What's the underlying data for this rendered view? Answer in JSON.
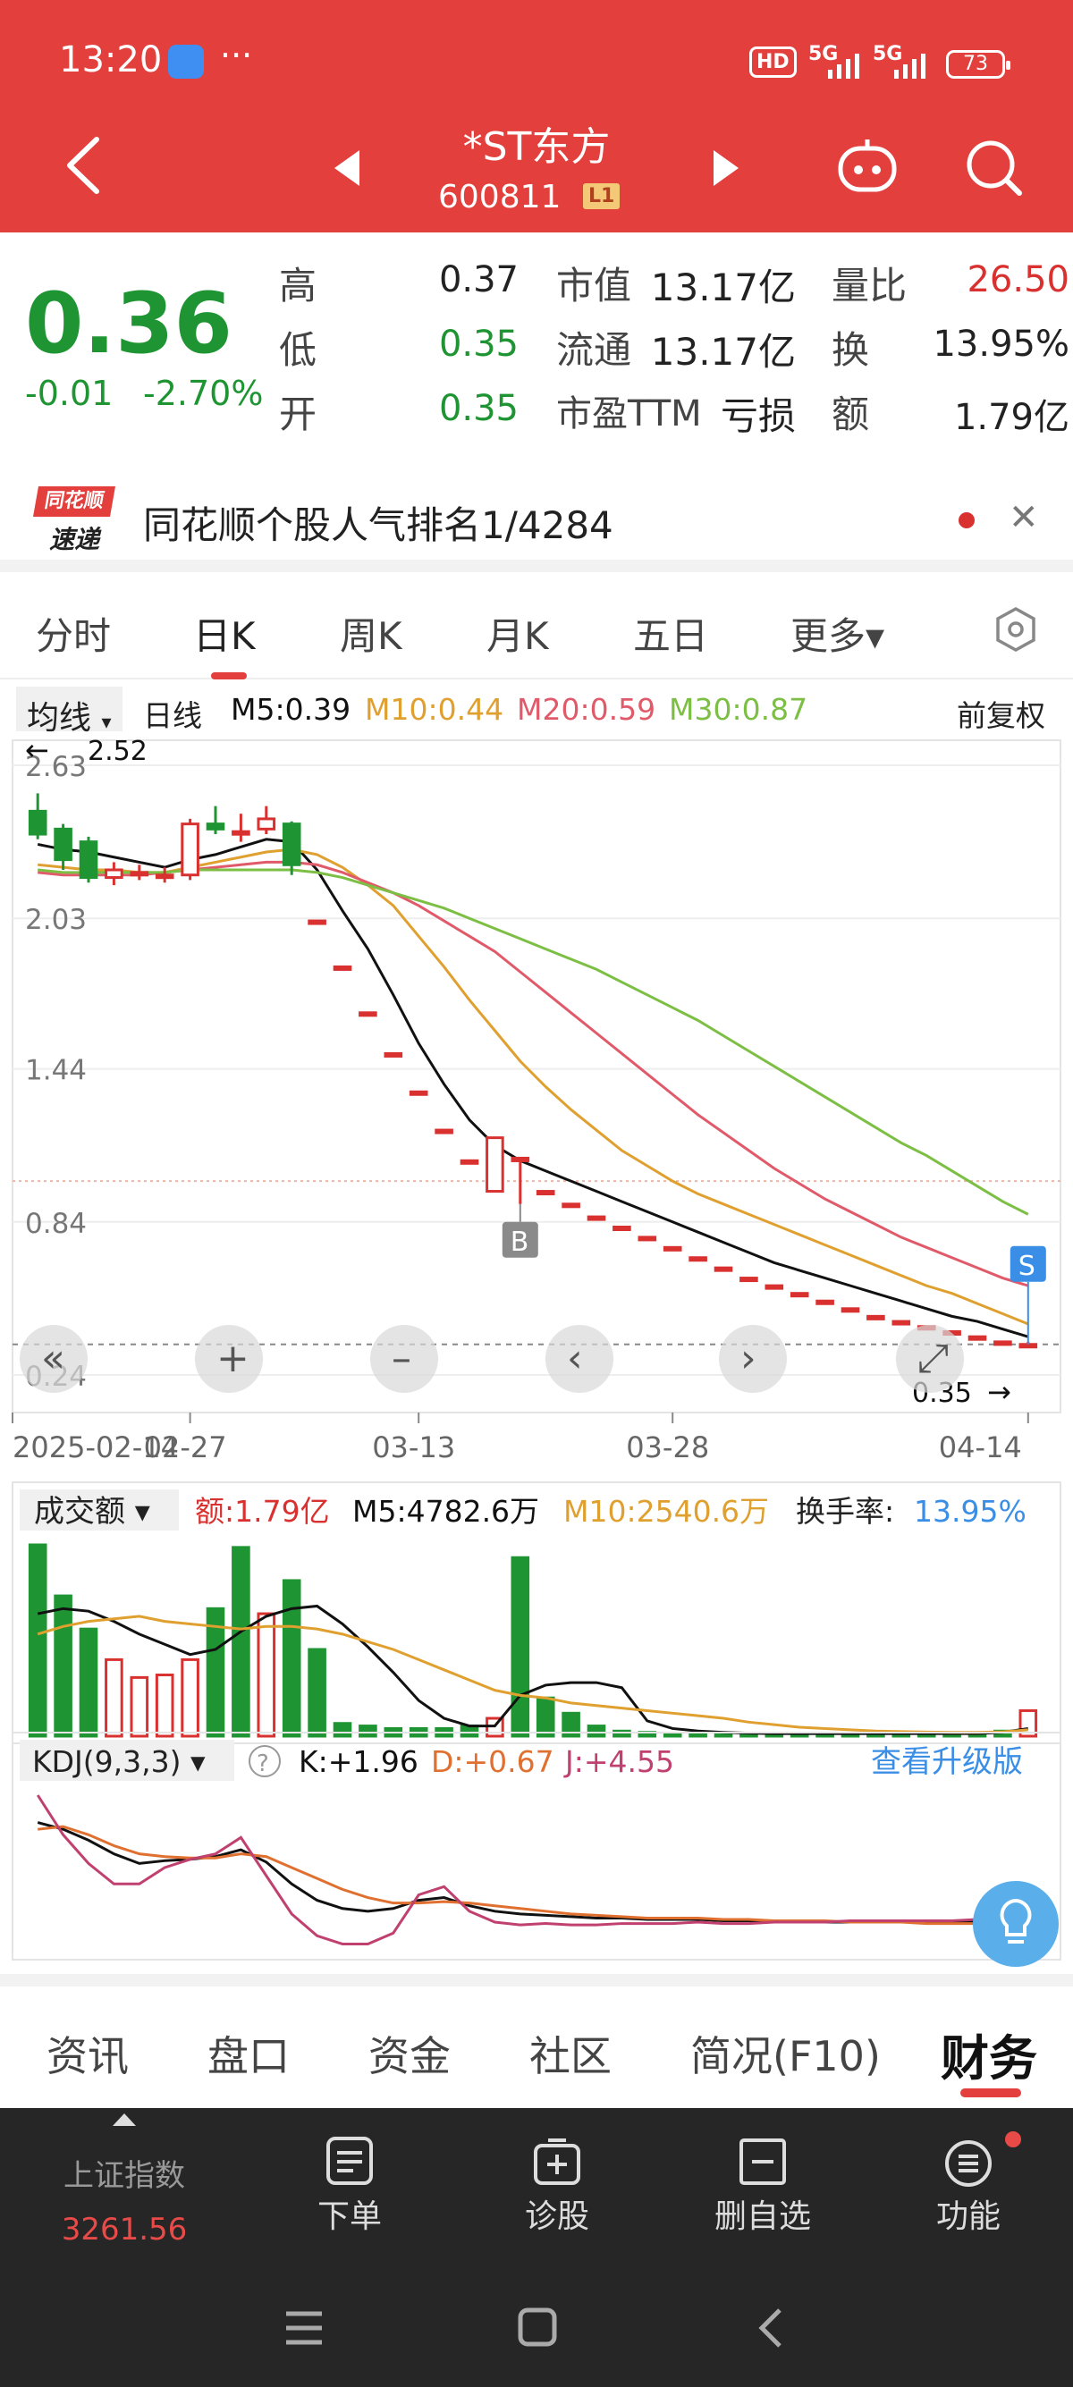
{
  "status_bar": {
    "time": "13:20",
    "more": "···",
    "hd": "HD",
    "net1": "5G",
    "net2": "5G",
    "battery": "73"
  },
  "header": {
    "name": "*ST东方",
    "code": "600811",
    "level": "L1"
  },
  "quote": {
    "price": "0.36",
    "change": "-0.01",
    "change_pct": "-2.70%",
    "high_label": "高",
    "high": "0.37",
    "low_label": "低",
    "low": "0.35",
    "open_label": "开",
    "open": "0.35",
    "mcap_label": "市值",
    "mcap": "13.17亿",
    "float_label": "流通",
    "float": "13.17亿",
    "pe_label": "市盈TTM",
    "pe": "亏损",
    "vr_label": "量比",
    "vr": "26.50",
    "turn_label": "换",
    "turn": "13.95%",
    "amt_label": "额",
    "amt": "1.79亿"
  },
  "banner": {
    "logo_top": "同花顺",
    "logo_bottom": "速递",
    "text": "同花顺个股人气排名1/4284"
  },
  "tabs": [
    "分时",
    "日K",
    "周K",
    "月K",
    "五日",
    "更多▾"
  ],
  "ma": {
    "dropdown": "均线",
    "period": "日线",
    "m5": "M5:0.39",
    "m10": "M10:0.44",
    "m20": "M20:0.59",
    "m30": "M30:0.87",
    "adjust": "前复权"
  },
  "colors": {
    "red": "#d8312f",
    "green": "#1e9532",
    "m5": "#111111",
    "m10": "#e0a030",
    "m20": "#e05a6a",
    "m30": "#7cbf44",
    "blue": "#3a8ee6"
  },
  "chart_data": [
    {
      "type": "candlestick",
      "title": "",
      "y_ticks": [
        "2.63",
        "2.03",
        "1.44",
        "0.84",
        "0.24"
      ],
      "x_ticks": [
        "2025-02-14",
        "02-27",
        "03-13",
        "03-28",
        "04-14"
      ],
      "ylim": [
        0.24,
        2.63
      ],
      "max_label": "2.52",
      "min_label": "0.35",
      "markers": {
        "buy": "B",
        "sell": "S"
      },
      "candles": [
        {
          "o": 2.45,
          "c": 2.36,
          "h": 2.52,
          "l": 2.34
        },
        {
          "o": 2.38,
          "c": 2.26,
          "h": 2.4,
          "l": 2.22
        },
        {
          "o": 2.33,
          "c": 2.19,
          "h": 2.35,
          "l": 2.17
        },
        {
          "o": 2.19,
          "c": 2.22,
          "h": 2.25,
          "l": 2.16
        },
        {
          "o": 2.2,
          "c": 2.21,
          "h": 2.24,
          "l": 2.18
        },
        {
          "o": 2.19,
          "c": 2.2,
          "h": 2.23,
          "l": 2.17
        },
        {
          "o": 2.2,
          "c": 2.4,
          "h": 2.42,
          "l": 2.18
        },
        {
          "o": 2.4,
          "c": 2.38,
          "h": 2.47,
          "l": 2.36
        },
        {
          "o": 2.37,
          "c": 2.37,
          "h": 2.44,
          "l": 2.33
        },
        {
          "o": 2.38,
          "c": 2.42,
          "h": 2.47,
          "l": 2.36
        },
        {
          "o": 2.4,
          "c": 2.24,
          "h": 2.41,
          "l": 2.2
        },
        {
          "o": 2.02,
          "c": 2.02,
          "h": 2.02,
          "l": 2.02
        },
        {
          "o": 1.84,
          "c": 1.84,
          "h": 1.84,
          "l": 1.84
        },
        {
          "o": 1.66,
          "c": 1.66,
          "h": 1.66,
          "l": 1.66
        },
        {
          "o": 1.5,
          "c": 1.5,
          "h": 1.5,
          "l": 1.5
        },
        {
          "o": 1.35,
          "c": 1.35,
          "h": 1.35,
          "l": 1.35
        },
        {
          "o": 1.2,
          "c": 1.2,
          "h": 1.2,
          "l": 1.2
        },
        {
          "o": 1.08,
          "c": 1.08,
          "h": 1.08,
          "l": 1.08
        },
        {
          "o": 0.96,
          "c": 1.17,
          "h": 1.17,
          "l": 0.96
        },
        {
          "o": 1.09,
          "c": 1.09,
          "h": 1.09,
          "l": 0.91
        },
        {
          "o": 0.96,
          "c": 0.96,
          "h": 0.96,
          "l": 0.96
        },
        {
          "o": 0.91,
          "c": 0.91,
          "h": 0.91,
          "l": 0.91
        },
        {
          "o": 0.86,
          "c": 0.86,
          "h": 0.86,
          "l": 0.86
        },
        {
          "o": 0.82,
          "c": 0.82,
          "h": 0.82,
          "l": 0.82
        },
        {
          "o": 0.78,
          "c": 0.78,
          "h": 0.78,
          "l": 0.78
        },
        {
          "o": 0.74,
          "c": 0.74,
          "h": 0.74,
          "l": 0.74
        },
        {
          "o": 0.7,
          "c": 0.7,
          "h": 0.7,
          "l": 0.7
        },
        {
          "o": 0.66,
          "c": 0.66,
          "h": 0.66,
          "l": 0.66
        },
        {
          "o": 0.62,
          "c": 0.62,
          "h": 0.62,
          "l": 0.62
        },
        {
          "o": 0.59,
          "c": 0.59,
          "h": 0.59,
          "l": 0.59
        },
        {
          "o": 0.56,
          "c": 0.56,
          "h": 0.56,
          "l": 0.56
        },
        {
          "o": 0.53,
          "c": 0.53,
          "h": 0.53,
          "l": 0.53
        },
        {
          "o": 0.5,
          "c": 0.5,
          "h": 0.5,
          "l": 0.5
        },
        {
          "o": 0.47,
          "c": 0.47,
          "h": 0.47,
          "l": 0.47
        },
        {
          "o": 0.45,
          "c": 0.45,
          "h": 0.45,
          "l": 0.45
        },
        {
          "o": 0.43,
          "c": 0.43,
          "h": 0.43,
          "l": 0.43
        },
        {
          "o": 0.41,
          "c": 0.41,
          "h": 0.41,
          "l": 0.41
        },
        {
          "o": 0.39,
          "c": 0.39,
          "h": 0.39,
          "l": 0.39
        },
        {
          "o": 0.37,
          "c": 0.37,
          "h": 0.37,
          "l": 0.37
        },
        {
          "o": 0.35,
          "c": 0.36,
          "h": 0.37,
          "l": 0.35
        }
      ],
      "series": [
        {
          "name": "M5",
          "values": [
            2.32,
            2.3,
            2.29,
            2.27,
            2.25,
            2.23,
            2.26,
            2.28,
            2.31,
            2.34,
            2.33,
            2.22,
            2.06,
            1.91,
            1.73,
            1.54,
            1.38,
            1.24,
            1.14,
            1.08,
            1.04,
            1.0,
            0.96,
            0.92,
            0.88,
            0.84,
            0.8,
            0.76,
            0.72,
            0.68,
            0.65,
            0.62,
            0.59,
            0.56,
            0.53,
            0.5,
            0.47,
            0.45,
            0.42,
            0.39
          ]
        },
        {
          "name": "M10",
          "values": [
            2.24,
            2.23,
            2.22,
            2.22,
            2.21,
            2.21,
            2.23,
            2.25,
            2.27,
            2.29,
            2.3,
            2.28,
            2.23,
            2.16,
            2.08,
            1.96,
            1.84,
            1.71,
            1.59,
            1.47,
            1.37,
            1.28,
            1.2,
            1.12,
            1.06,
            1.0,
            0.95,
            0.91,
            0.87,
            0.83,
            0.79,
            0.75,
            0.71,
            0.67,
            0.63,
            0.59,
            0.56,
            0.52,
            0.48,
            0.44
          ]
        },
        {
          "name": "M20",
          "values": [
            2.21,
            2.2,
            2.2,
            2.2,
            2.2,
            2.21,
            2.22,
            2.23,
            2.24,
            2.25,
            2.25,
            2.24,
            2.21,
            2.17,
            2.13,
            2.08,
            2.02,
            1.96,
            1.9,
            1.82,
            1.74,
            1.66,
            1.58,
            1.5,
            1.42,
            1.34,
            1.26,
            1.19,
            1.12,
            1.05,
            0.99,
            0.93,
            0.88,
            0.83,
            0.78,
            0.74,
            0.7,
            0.66,
            0.62,
            0.59
          ]
        },
        {
          "name": "M30",
          "values": [
            2.22,
            2.21,
            2.21,
            2.21,
            2.21,
            2.21,
            2.22,
            2.22,
            2.22,
            2.22,
            2.22,
            2.21,
            2.19,
            2.16,
            2.13,
            2.1,
            2.07,
            2.03,
            1.99,
            1.95,
            1.91,
            1.87,
            1.83,
            1.78,
            1.73,
            1.68,
            1.63,
            1.57,
            1.51,
            1.45,
            1.39,
            1.33,
            1.27,
            1.21,
            1.15,
            1.1,
            1.04,
            0.98,
            0.92,
            0.87
          ]
        }
      ]
    },
    {
      "type": "bar",
      "title": "",
      "dropdown": "成交额",
      "amount": "额:1.79亿",
      "m5": "M5:4782.6万",
      "m10": "M10:2540.6万",
      "turnover_label": "换手率:",
      "turnover": "13.95%",
      "values": [
        7.5,
        5.5,
        4.2,
        3.0,
        2.3,
        2.4,
        3.0,
        5.0,
        7.4,
        4.8,
        6.1,
        3.4,
        0.5,
        0.4,
        0.3,
        0.3,
        0.3,
        0.4,
        0.7,
        7.0,
        1.5,
        0.9,
        0.4,
        0.2,
        0.15,
        0.12,
        0.1,
        0.1,
        0.1,
        0.1,
        0.1,
        0.1,
        0.1,
        0.1,
        0.1,
        0.1,
        0.1,
        0.1,
        0.2,
        1.0
      ],
      "series": [
        {
          "name": "M5",
          "values": [
            4.8,
            5.0,
            4.9,
            4.5,
            4.0,
            3.6,
            3.2,
            3.4,
            4.1,
            4.7,
            5.0,
            5.1,
            4.4,
            3.5,
            2.5,
            1.4,
            0.7,
            0.4,
            0.4,
            1.6,
            2.0,
            2.1,
            2.1,
            1.9,
            0.6,
            0.3,
            0.2,
            0.15,
            0.12,
            0.1,
            0.1,
            0.1,
            0.1,
            0.1,
            0.1,
            0.1,
            0.1,
            0.1,
            0.15,
            0.3
          ]
        },
        {
          "name": "M10",
          "values": [
            4.0,
            4.3,
            4.5,
            4.6,
            4.7,
            4.5,
            4.4,
            4.3,
            4.2,
            4.3,
            4.3,
            4.2,
            4.0,
            3.7,
            3.4,
            3.0,
            2.6,
            2.2,
            1.8,
            1.6,
            1.5,
            1.3,
            1.2,
            1.1,
            1.0,
            0.9,
            0.8,
            0.7,
            0.55,
            0.45,
            0.35,
            0.3,
            0.25,
            0.2,
            0.18,
            0.16,
            0.15,
            0.15,
            0.17,
            0.25
          ]
        }
      ]
    },
    {
      "type": "line",
      "title": "",
      "dropdown": "KDJ(9,3,3)",
      "k_label": "K:+1.96",
      "d_label": "D:+0.67",
      "j_label": "J:+4.55",
      "upgrade": "查看升级版",
      "series": [
        {
          "name": "K",
          "values": [
            75,
            70,
            62,
            52,
            45,
            47,
            48,
            50,
            55,
            46,
            30,
            18,
            12,
            10,
            12,
            18,
            20,
            14,
            10,
            8,
            7,
            6,
            5,
            5,
            4,
            4,
            4,
            3,
            3,
            3,
            3,
            2,
            2,
            2,
            2,
            2,
            2,
            2,
            2,
            2
          ]
        },
        {
          "name": "D",
          "values": [
            70,
            72,
            66,
            58,
            52,
            50,
            49,
            49,
            52,
            50,
            42,
            34,
            26,
            20,
            16,
            16,
            17,
            16,
            14,
            12,
            10,
            8,
            7,
            6,
            5,
            5,
            5,
            4,
            4,
            3,
            3,
            3,
            2,
            2,
            2,
            1,
            1,
            1,
            1,
            1
          ]
        },
        {
          "name": "J",
          "values": [
            95,
            66,
            45,
            30,
            30,
            42,
            48,
            52,
            64,
            36,
            8,
            -8,
            -14,
            -14,
            -6,
            22,
            28,
            10,
            2,
            0,
            1,
            0,
            0,
            1,
            1,
            1,
            2,
            1,
            1,
            2,
            2,
            2,
            3,
            3,
            3,
            3,
            3,
            4,
            4,
            5
          ]
        }
      ]
    }
  ],
  "bottom_tabs": [
    "资讯",
    "盘口",
    "资金",
    "社区",
    "简况(F10)",
    "财务"
  ],
  "toolbar": {
    "index_name": "上证指数",
    "index_value": "3261.56",
    "order": "下单",
    "diagnose": "诊股",
    "remove": "删自选",
    "func": "功能"
  }
}
